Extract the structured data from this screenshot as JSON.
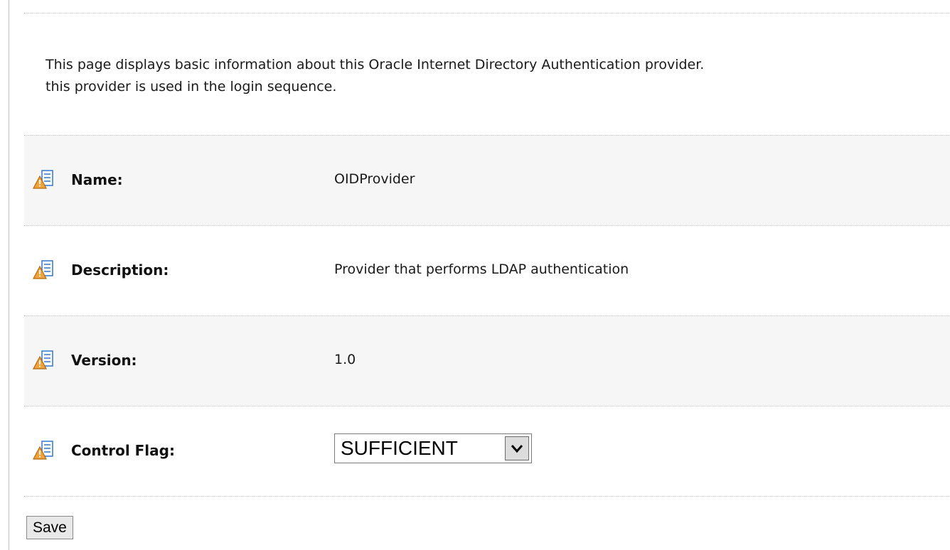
{
  "intro": {
    "line1": "This page displays basic information about this Oracle Internet Directory Authentication provider.",
    "line2": "this provider is used in the login sequence."
  },
  "fields": [
    {
      "label": "Name:",
      "value": "OIDProvider"
    },
    {
      "label": "Description:",
      "value": "Provider that performs LDAP authentication"
    },
    {
      "label": "Version:",
      "value": "1.0"
    },
    {
      "label": "Control Flag:",
      "value": "SUFFICIENT"
    }
  ],
  "icons": {
    "field_icon": "warning-field-icon",
    "dropdown_icon": "chevron-down-icon"
  },
  "actions": {
    "save_label": "Save"
  },
  "colors": {
    "row_shade": "#f6f6f6",
    "icon_warning": "#f2a23a",
    "icon_blue": "#3d7fcf"
  }
}
